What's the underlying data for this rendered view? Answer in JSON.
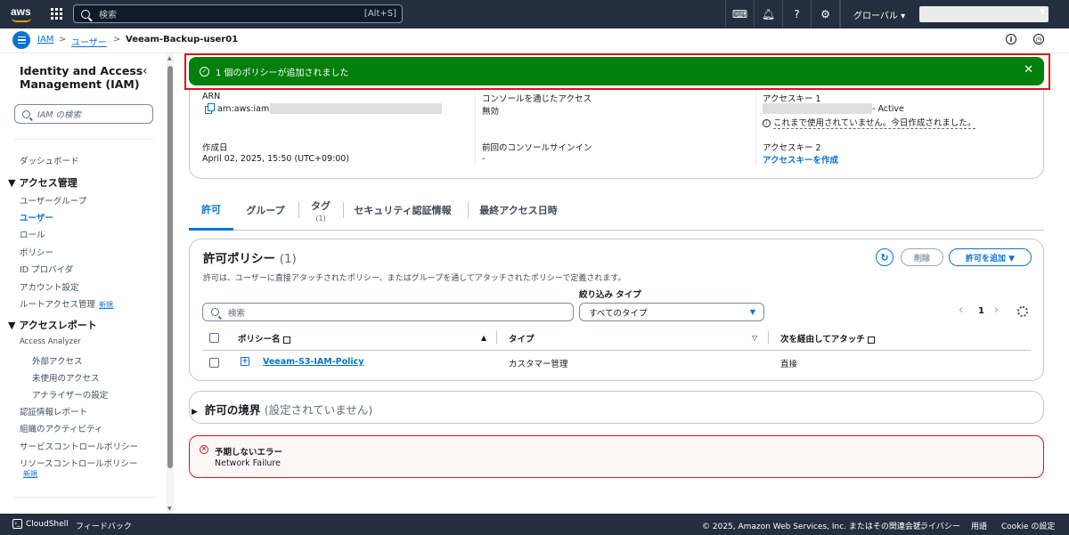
{
  "topbar": {
    "search_placeholder": "検索",
    "search_shortcut": "[Alt+S]",
    "region": "グローバル ▾",
    "icons": [
      "cloudshell-icon",
      "bell-icon",
      "help-icon",
      "settings-icon"
    ]
  },
  "breadcrumb": {
    "items": [
      "IAM",
      "ユーザー",
      "Veeam-Backup-user01"
    ],
    "separator": ">"
  },
  "sidebar": {
    "title": "Identity and Access Management (IAM)",
    "close_glyph": "‹",
    "search_placeholder": "IAM の検索",
    "dashboard": "ダッシュボード",
    "section_access": "アクセス管理",
    "access_items": [
      "ユーザーグループ",
      "ユーザー",
      "ロール",
      "ポリシー",
      "ID プロバイダ",
      "アカウント設定",
      "ルートアクセス管理"
    ],
    "new_tag": "新規",
    "section_reports": "アクセスレポート",
    "reports_items": [
      "Access Analyzer",
      "外部アクセス",
      "未使用のアクセス",
      "アナライザーの設定",
      "認証情報レポート",
      "組織のアクティビティ",
      "サービスコントロールポリシー",
      "リソースコントロールポリシー"
    ],
    "section_caret": "▼"
  },
  "flash": {
    "message": "1 個のポリシーが追加されました",
    "close_glyph": "✕",
    "status_color": "#037f0c"
  },
  "summary": {
    "arn_label": "ARN",
    "arn_value": "arn:aws:iam::",
    "created_label": "作成日",
    "created_value": "April 02, 2025, 15:50 (UTC+09:00)",
    "console_access_label": "コンソールを通じたアクセス",
    "console_access_value": "無効",
    "last_signin_label": "前回のコンソールサインイン",
    "last_signin_value": "-",
    "access_key1_label": "アクセスキー 1",
    "access_key1_status": "- Active",
    "access_key1_note": "これまで使用されていません。今日作成されました。",
    "access_key2_label": "アクセスキー 2",
    "create_access_key": "アクセスキーを作成"
  },
  "tabs": [
    {
      "label": "許可",
      "count": ""
    },
    {
      "label": "グループ",
      "count": ""
    },
    {
      "label": "タグ",
      "count": "(1)"
    },
    {
      "label": "セキュリティ認証情報",
      "count": ""
    },
    {
      "label": "最終アクセス日時",
      "count": ""
    }
  ],
  "permissions": {
    "title": "許可ポリシー",
    "count": "(1)",
    "description": "許可は、ユーザーに直接アタッチされたポリシー、またはグループを通してアタッチされたポリシーで定義されます。",
    "refresh_glyph": "↻",
    "delete_label": "削除",
    "add_label": "許可を追加 ▼",
    "filter_type_label": "絞り込み タイプ",
    "search_placeholder": "検索",
    "type_select_value": "すべてのタイプ",
    "type_select_caret": "▼",
    "page_prev": "‹",
    "page_number": "1",
    "page_next": "›",
    "columns": [
      "ポリシー名",
      "タイプ",
      "次を経由してアタッチ"
    ],
    "sort_asc": "▲",
    "sort_none": "▽",
    "rows": [
      {
        "name": "Veeam-S3-IAM-Policy",
        "type": "カスタマー管理",
        "attached_via": "直接"
      }
    ]
  },
  "boundary": {
    "title": "許可の境界",
    "note": "(設定されていません)",
    "caret": "▶"
  },
  "error": {
    "title": "予期しないエラー",
    "message": "Network Failure",
    "icon_glyph": "×"
  },
  "footer": {
    "cloudshell": "CloudShell",
    "feedback": "フィードバック",
    "copyright": "© 2025, Amazon Web Services, Inc. またはその関連会社。",
    "privacy": "プライバシー",
    "terms": "用語",
    "cookie": "Cookie の設定"
  }
}
